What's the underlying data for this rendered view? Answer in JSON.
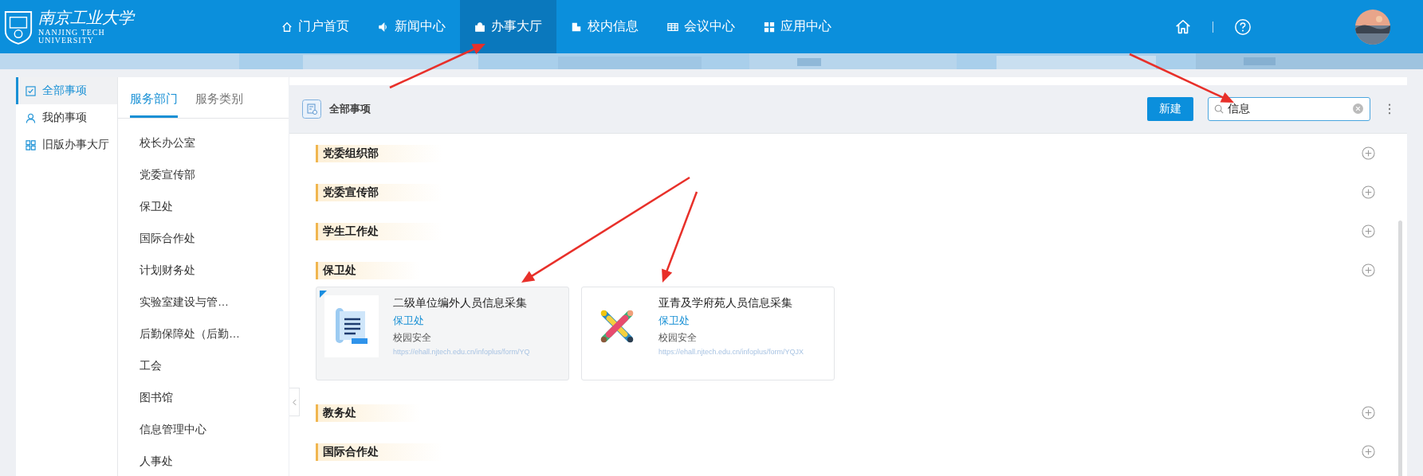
{
  "logo": {
    "name": "南京工业大学",
    "english": [
      "NANJING TECH",
      "UNIVERSITY"
    ]
  },
  "nav": [
    {
      "label": "门户首页",
      "kind": "home",
      "selected": false
    },
    {
      "label": "新闻中心",
      "kind": "speaker",
      "selected": false
    },
    {
      "label": "办事大厅",
      "kind": "bag",
      "selected": true
    },
    {
      "label": "校内信息",
      "kind": "building",
      "selected": false
    },
    {
      "label": "会议中心",
      "kind": "table",
      "selected": false
    },
    {
      "label": "应用中心",
      "kind": "grid",
      "selected": false
    }
  ],
  "side_menu": [
    {
      "label": "全部事项",
      "kind": "check",
      "selected": true
    },
    {
      "label": "我的事项",
      "kind": "user",
      "selected": false
    },
    {
      "label": "旧版办事大厅",
      "kind": "grid",
      "selected": false
    }
  ],
  "dept_tabs": [
    {
      "label": "服务部门",
      "selected": true
    },
    {
      "label": "服务类别",
      "selected": false
    }
  ],
  "departments": [
    "校长办公室",
    "党委宣传部",
    "保卫处",
    "国际合作处",
    "计划财务处",
    "实验室建设与管…",
    "后勤保障处（后勤…",
    "工会",
    "图书馆",
    "信息管理中心",
    "人事处"
  ],
  "header": {
    "title": "全部事项",
    "new_button": "新建",
    "search": {
      "value": "信息"
    }
  },
  "sections": [
    {
      "title": "党委组织部"
    },
    {
      "title": "党委宣传部"
    },
    {
      "title": "学生工作处"
    },
    {
      "title": "保卫处",
      "cards": [
        {
          "kind": "document",
          "title": "二级单位编外人员信息采集",
          "department": "保卫处",
          "category": "校园安全",
          "url": "https://ehall.njtech.edu.cn/infoplus/form/YQ",
          "selected": true
        },
        {
          "kind": "people",
          "title": "亚青及学府苑人员信息采集",
          "department": "保卫处",
          "category": "校园安全",
          "url": "https://ehall.njtech.edu.cn/infoplus/form/YQJX",
          "selected": false
        }
      ]
    },
    {
      "title": "教务处"
    },
    {
      "title": "国际合作处"
    }
  ]
}
